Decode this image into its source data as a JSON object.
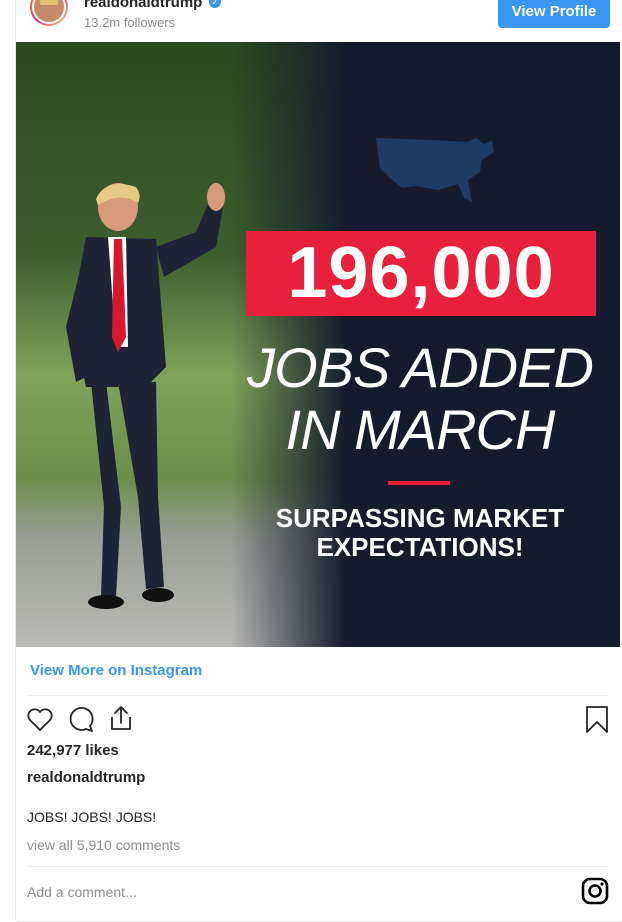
{
  "header": {
    "username": "realdonaldtrump",
    "followers": "13.2m followers",
    "view_profile_label": "View Profile"
  },
  "post": {
    "image": {
      "number": "196,000",
      "line1": "JOBS ADDED",
      "line2": "IN MARCH",
      "subhead_line1": "SURPASSING MARKET",
      "subhead_line2": "EXPECTATIONS!"
    },
    "view_more_label": "View More on Instagram",
    "likes": "242,977 likes",
    "owner": "realdonaldtrump",
    "caption": "JOBS! JOBS! JOBS!",
    "comments_link": "view all 5,910 comments",
    "comment_placeholder": "Add a comment..."
  },
  "colors": {
    "accent": "#3897f0",
    "brand_red": "#e8203b",
    "navy": "#151b2c"
  },
  "icons": [
    "verified-badge-icon",
    "heart-icon",
    "comment-icon",
    "share-icon",
    "bookmark-icon",
    "instagram-icon"
  ]
}
